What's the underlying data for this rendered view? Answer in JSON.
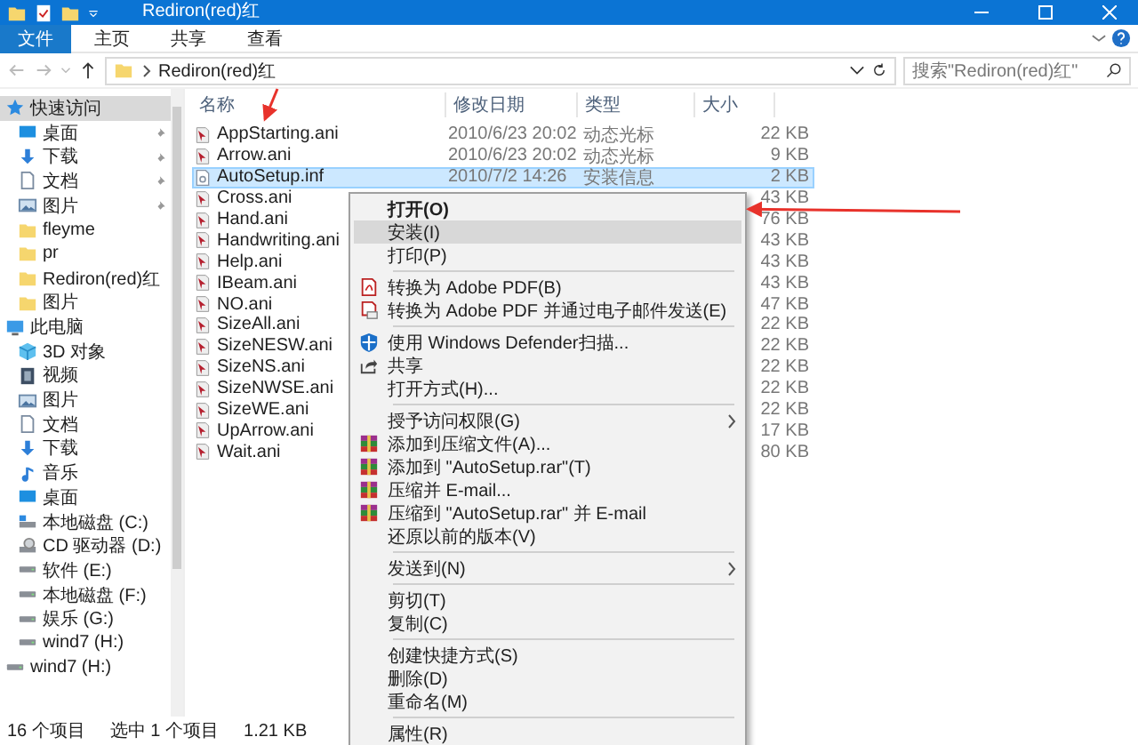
{
  "window": {
    "title": "Rediron(red)红"
  },
  "ribbon_tabs": [
    {
      "label": "文件",
      "selected": true
    },
    {
      "label": "主页",
      "selected": false
    },
    {
      "label": "共享",
      "selected": false
    },
    {
      "label": "查看",
      "selected": false
    }
  ],
  "address": {
    "path": "Rediron(red)红",
    "search_placeholder": "搜索\"Rediron(red)红\""
  },
  "sidebar": {
    "items": [
      {
        "label": "快速访问",
        "kind": "star",
        "selected": true,
        "children": [
          {
            "label": "桌面",
            "kind": "desktop",
            "pinned": true,
            "selected": false
          },
          {
            "label": "下载",
            "kind": "download",
            "pinned": true,
            "selected": false
          },
          {
            "label": "文档",
            "kind": "document",
            "pinned": true,
            "selected": false
          },
          {
            "label": "图片",
            "kind": "pictures",
            "pinned": true,
            "selected": false
          },
          {
            "label": "fleyme",
            "kind": "folder",
            "pinned": false,
            "selected": false
          },
          {
            "label": "pr",
            "kind": "folder",
            "pinned": false,
            "selected": false
          },
          {
            "label": "Rediron(red)红",
            "kind": "folder",
            "pinned": false,
            "selected": false
          },
          {
            "label": "图片",
            "kind": "folder",
            "pinned": false,
            "selected": false
          }
        ]
      },
      {
        "label": "此电脑",
        "kind": "pc",
        "selected": false,
        "children": [
          {
            "label": "3D 对象",
            "kind": "cube",
            "selected": false
          },
          {
            "label": "视频",
            "kind": "video",
            "selected": false
          },
          {
            "label": "图片",
            "kind": "pictures",
            "selected": false
          },
          {
            "label": "文档",
            "kind": "document",
            "selected": false
          },
          {
            "label": "下载",
            "kind": "download",
            "selected": false
          },
          {
            "label": "音乐",
            "kind": "music",
            "selected": false
          },
          {
            "label": "桌面",
            "kind": "desktop",
            "selected": false
          },
          {
            "label": "本地磁盘 (C:)",
            "kind": "system-drive",
            "selected": false
          },
          {
            "label": "CD 驱动器 (D:)",
            "kind": "cd",
            "selected": false
          },
          {
            "label": "软件 (E:)",
            "kind": "drive",
            "selected": false
          },
          {
            "label": "本地磁盘 (F:)",
            "kind": "drive",
            "selected": false
          },
          {
            "label": "娱乐 (G:)",
            "kind": "drive",
            "selected": false
          },
          {
            "label": "wind7 (H:)",
            "kind": "drive",
            "selected": false
          }
        ]
      },
      {
        "label": "wind7 (H:)",
        "kind": "drive",
        "selected": false
      }
    ]
  },
  "table": {
    "columns": [
      "名称",
      "修改日期",
      "类型",
      "大小"
    ],
    "rows": [
      {
        "name": "AppStarting.ani",
        "kind": "cursor",
        "date": "2010/6/23 20:02",
        "type": "动态光标",
        "size": "22 KB",
        "selected": false
      },
      {
        "name": "Arrow.ani",
        "kind": "cursor",
        "date": "2010/6/23 20:02",
        "type": "动态光标",
        "size": "9 KB",
        "selected": false
      },
      {
        "name": "AutoSetup.inf",
        "kind": "setup",
        "date": "2010/7/2 14:26",
        "type": "安装信息",
        "size": "2 KB",
        "selected": true
      },
      {
        "name": "Cross.ani",
        "kind": "cursor",
        "size": "43 KB",
        "selected": false
      },
      {
        "name": "Hand.ani",
        "kind": "cursor",
        "size": "76 KB",
        "selected": false
      },
      {
        "name": "Handwriting.ani",
        "kind": "cursor",
        "size": "43 KB",
        "selected": false
      },
      {
        "name": "Help.ani",
        "kind": "cursor",
        "size": "43 KB",
        "selected": false
      },
      {
        "name": "IBeam.ani",
        "kind": "cursor",
        "size": "43 KB",
        "selected": false
      },
      {
        "name": "NO.ani",
        "kind": "cursor",
        "size": "47 KB",
        "selected": false
      },
      {
        "name": "SizeAll.ani",
        "kind": "cursor",
        "size": "22 KB",
        "selected": false
      },
      {
        "name": "SizeNESW.ani",
        "kind": "cursor",
        "size": "22 KB",
        "selected": false
      },
      {
        "name": "SizeNS.ani",
        "kind": "cursor",
        "size": "22 KB",
        "selected": false
      },
      {
        "name": "SizeNWSE.ani",
        "kind": "cursor",
        "size": "22 KB",
        "selected": false
      },
      {
        "name": "SizeWE.ani",
        "kind": "cursor",
        "size": "22 KB",
        "selected": false
      },
      {
        "name": "UpArrow.ani",
        "kind": "cursor",
        "size": "17 KB",
        "selected": false
      },
      {
        "name": "Wait.ani",
        "kind": "cursor",
        "size": "80 KB",
        "selected": false
      }
    ]
  },
  "context_menu": {
    "groups": [
      [
        {
          "label": "打开(O)",
          "kind": "plain",
          "default": true,
          "selected": false,
          "submenu": false
        },
        {
          "label": "安装(I)",
          "kind": "plain",
          "default": false,
          "selected": true,
          "submenu": false
        },
        {
          "label": "打印(P)",
          "kind": "plain",
          "default": false,
          "selected": false,
          "submenu": false
        }
      ],
      [
        {
          "label": "转换为 Adobe PDF(B)",
          "kind": "pdf",
          "default": false,
          "selected": false,
          "submenu": false
        },
        {
          "label": "转换为 Adobe PDF 并通过电子邮件发送(E)",
          "kind": "pdf-mail",
          "default": false,
          "selected": false,
          "submenu": false
        }
      ],
      [
        {
          "label": "使用 Windows Defender扫描...",
          "kind": "shield",
          "default": false,
          "selected": false,
          "submenu": false
        },
        {
          "label": "共享",
          "kind": "share",
          "default": false,
          "selected": false,
          "submenu": false
        },
        {
          "label": "打开方式(H)...",
          "kind": "plain",
          "default": false,
          "selected": false,
          "submenu": false
        }
      ],
      [
        {
          "label": "授予访问权限(G)",
          "kind": "plain",
          "default": false,
          "selected": false,
          "submenu": true
        },
        {
          "label": "添加到压缩文件(A)...",
          "kind": "archive",
          "default": false,
          "selected": false,
          "submenu": false
        },
        {
          "label": "添加到 \"AutoSetup.rar\"(T)",
          "kind": "archive",
          "default": false,
          "selected": false,
          "submenu": false
        },
        {
          "label": "压缩并 E-mail...",
          "kind": "archive",
          "default": false,
          "selected": false,
          "submenu": false
        },
        {
          "label": "压缩到 \"AutoSetup.rar\" 并 E-mail",
          "kind": "archive",
          "default": false,
          "selected": false,
          "submenu": false
        },
        {
          "label": "还原以前的版本(V)",
          "kind": "plain",
          "default": false,
          "selected": false,
          "submenu": false
        }
      ],
      [
        {
          "label": "发送到(N)",
          "kind": "plain",
          "default": false,
          "selected": false,
          "submenu": true
        }
      ],
      [
        {
          "label": "剪切(T)",
          "kind": "plain",
          "default": false,
          "selected": false,
          "submenu": false
        },
        {
          "label": "复制(C)",
          "kind": "plain",
          "default": false,
          "selected": false,
          "submenu": false
        }
      ],
      [
        {
          "label": "创建快捷方式(S)",
          "kind": "plain",
          "default": false,
          "selected": false,
          "submenu": false
        },
        {
          "label": "删除(D)",
          "kind": "plain",
          "default": false,
          "selected": false,
          "submenu": false
        },
        {
          "label": "重命名(M)",
          "kind": "plain",
          "default": false,
          "selected": false,
          "submenu": false
        }
      ],
      [
        {
          "label": "属性(R)",
          "kind": "plain",
          "default": false,
          "selected": false,
          "submenu": false
        }
      ]
    ]
  },
  "status_bar": {
    "count": "16 个项目",
    "selection": "选中 1 个项目",
    "size": "1.21 KB"
  }
}
